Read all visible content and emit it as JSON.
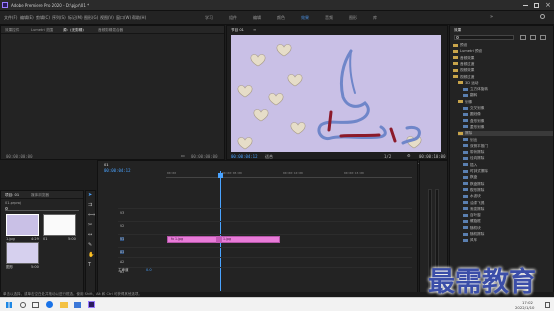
{
  "titlebar": {
    "title": "Adobe Premiere Pro 2020 - D:\\pjpr\\01 *"
  },
  "menu": [
    "文件(F)",
    "编辑(E)",
    "剪辑(C)",
    "序列(S)",
    "标记(M)",
    "图形(G)",
    "视图(V)",
    "窗口(W)",
    "帮助(H)"
  ],
  "workspaces": {
    "items": [
      "学习",
      "组件",
      "编辑",
      "颜色",
      "效果",
      "音频",
      "图形",
      "库"
    ],
    "active": "效果"
  },
  "source_panel": {
    "tabs": [
      "效果控件",
      "Lumetri 范围",
      "源：(无剪辑)",
      "音频剪辑混合器"
    ],
    "timecode_left": "00:00:00:00",
    "timecode_right": "00:00:00:00"
  },
  "program_panel": {
    "tab": "节目 01",
    "timecode": "00:00:04:12",
    "fit": "适合",
    "quality": "1/2",
    "duration": "00:00:10:00"
  },
  "project_panel": {
    "tabs": [
      "项目: 01",
      "媒体浏览器"
    ],
    "path": "01.prproj",
    "items": [
      {
        "name": "1.jpg",
        "duration": "4:29"
      },
      {
        "name": "01",
        "duration": "5:00"
      },
      {
        "name": "图形",
        "duration": "5:00"
      }
    ]
  },
  "timeline": {
    "tab": "01",
    "timecode": "00:00:04:12",
    "ruler": [
      "00:00",
      "00:00:05:00",
      "00:00:10:00",
      "00:00:15:00"
    ],
    "tracks": [
      "V3",
      "V2",
      "V1",
      "A1",
      "A2",
      "A3"
    ],
    "master": "主声道",
    "master_value": "0.0",
    "clip_a": "fx 1.jpg",
    "clip_b": "fx 1.jpg"
  },
  "effects_panel": {
    "title": "效果",
    "items": [
      {
        "label": "预设",
        "kind": "folder",
        "indent": 0
      },
      {
        "label": "Lumetri 预设",
        "kind": "folder",
        "indent": 0
      },
      {
        "label": "音频效果",
        "kind": "folder",
        "indent": 0
      },
      {
        "label": "音频过渡",
        "kind": "folder",
        "indent": 0
      },
      {
        "label": "视频效果",
        "kind": "folder",
        "indent": 0
      },
      {
        "label": "视频过渡",
        "kind": "folder",
        "indent": 0
      },
      {
        "label": "3D 运动",
        "kind": "folder",
        "indent": 1
      },
      {
        "label": "立方体旋转",
        "kind": "effect",
        "indent": 2
      },
      {
        "label": "翻转",
        "kind": "effect",
        "indent": 2
      },
      {
        "label": "划像",
        "kind": "folder",
        "indent": 1
      },
      {
        "label": "交叉划像",
        "kind": "effect",
        "indent": 2
      },
      {
        "label": "圆划像",
        "kind": "effect",
        "indent": 2
      },
      {
        "label": "盒形划像",
        "kind": "effect",
        "indent": 2
      },
      {
        "label": "菱形划像",
        "kind": "effect",
        "indent": 2
      },
      {
        "label": "擦除",
        "kind": "folder",
        "indent": 1
      },
      {
        "label": "划出",
        "kind": "effect",
        "indent": 2
      },
      {
        "label": "双侧平推门",
        "kind": "effect",
        "indent": 2
      },
      {
        "label": "带状擦除",
        "kind": "effect",
        "indent": 2
      },
      {
        "label": "径向擦除",
        "kind": "effect",
        "indent": 2
      },
      {
        "label": "插入",
        "kind": "effect",
        "indent": 2
      },
      {
        "label": "时钟式擦除",
        "kind": "effect",
        "indent": 2
      },
      {
        "label": "棋盘",
        "kind": "effect",
        "indent": 2
      },
      {
        "label": "棋盘擦除",
        "kind": "effect",
        "indent": 2
      },
      {
        "label": "楔形擦除",
        "kind": "effect",
        "indent": 2
      },
      {
        "label": "水波块",
        "kind": "effect",
        "indent": 2
      },
      {
        "label": "油漆飞溅",
        "kind": "effect",
        "indent": 2
      },
      {
        "label": "渐变擦除",
        "kind": "effect",
        "indent": 2
      },
      {
        "label": "百叶窗",
        "kind": "effect",
        "indent": 2
      },
      {
        "label": "螺旋框",
        "kind": "effect",
        "indent": 2
      },
      {
        "label": "随机块",
        "kind": "effect",
        "indent": 2
      },
      {
        "label": "随机擦除",
        "kind": "effect",
        "indent": 2
      },
      {
        "label": "风车",
        "kind": "effect",
        "indent": 2
      }
    ]
  },
  "status": {
    "text": "单击以选择，或单击空白处并拖动以进行框选。使用 Shift、Alt 和 Ctrl 可获得其他选项。"
  },
  "taskbar": {
    "time": "17:02",
    "date": "2022/1/10"
  },
  "watermark": {
    "text": "最需教育"
  },
  "colors": {
    "accent": "#4a90e2",
    "clip": "#e87bd8",
    "canvas": "#c9c0e6",
    "stroke_blue": "#6f86c9",
    "stroke_red": "#8c1a2a",
    "playhead": "#4aa3ff"
  }
}
